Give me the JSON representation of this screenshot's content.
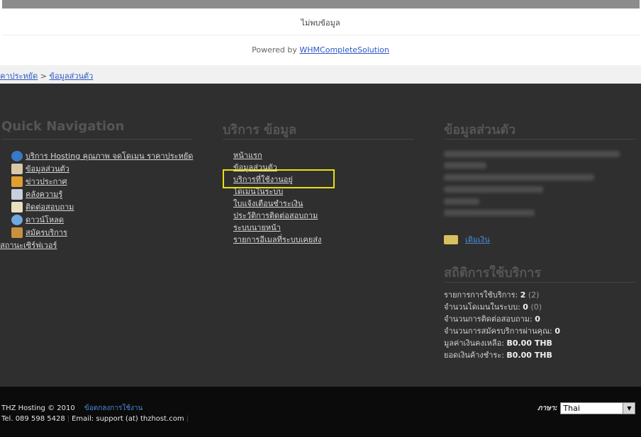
{
  "top": {
    "no_data": "ไม่พบข้อมูล",
    "powered_prefix": "Powered by ",
    "powered_link": "WHMCompleteSolution"
  },
  "breadcrumb": {
    "item1": "ราคาประหยัด",
    "separator": " > ",
    "item2": "ข้อมูลส่วนตัว"
  },
  "quick_nav": {
    "title": "Quick Navigation",
    "items": [
      {
        "label": "บริการ Hosting คุณภาพ จดโดเมน ราคาประหยัด",
        "icon": "info-icon"
      },
      {
        "label": "ข้อมูลส่วนตัว",
        "icon": "home-icon"
      },
      {
        "label": "ข่าวประกาศ",
        "icon": "announcement-icon"
      },
      {
        "label": "คลังความรู้",
        "icon": "knowledgebase-icon"
      },
      {
        "label": "ติดต่อสอบถาม",
        "icon": "support-icon"
      },
      {
        "label": "ดาวน์โหลด",
        "icon": "download-icon"
      },
      {
        "label": "สมัครบริการ",
        "icon": "order-icon"
      },
      {
        "label": "สถานะเซิร์ฟเวอร์",
        "icon": ""
      }
    ]
  },
  "services": {
    "title": "บริการ ข้อมูล",
    "items": [
      "หน้าแรก",
      "ข้อมูลส่วนตัว",
      "บริการที่ใช้งานอยู่",
      "โดเมนในระบบ",
      "ใบแจ้งเตือนชำระเงิน",
      "ประวัติการติดต่อสอบถาม",
      "ระบบนายหน้า",
      "รายการอีเมลที่ระบบเคยส่ง"
    ]
  },
  "profile": {
    "title": "ข้อมูลส่วนตัว",
    "deposit_link": "เติมเงิน"
  },
  "usage": {
    "title": "สถิติการใช้บริการ",
    "rows": [
      {
        "label": "รายการการใช้บริการ: ",
        "value": "2",
        "extra": " (2)"
      },
      {
        "label": "จำนวนโดเมนในระบบ: ",
        "value": "0",
        "extra": " (0)"
      },
      {
        "label": "จำนวนการติดต่อสอบถาม: ",
        "value": "0",
        "extra": ""
      },
      {
        "label": "จำนวนการสมัครบริการผ่านคุณ: ",
        "value": "0",
        "extra": ""
      },
      {
        "label": "มูลค่าเงินคงเหลือ: ",
        "value": "B0.00 THB",
        "extra": ""
      },
      {
        "label": "ยอดเงินค้างชำระ: ",
        "value": "B0.00 THB",
        "extra": ""
      }
    ]
  },
  "footer": {
    "copyright": "THZ Hosting © 2010",
    "terms_link": "ข้อตกลงการใช้งาน",
    "tel": "Tel. 089 598 5428",
    "email": "Email: support (at) thzhost.com",
    "language_label": "ภาษา:",
    "language_value": "Thai"
  },
  "colors": {
    "highlight_box": "#e8e010",
    "link_blue": "#2b58c6",
    "panel_bg": "#2f2f2f"
  }
}
